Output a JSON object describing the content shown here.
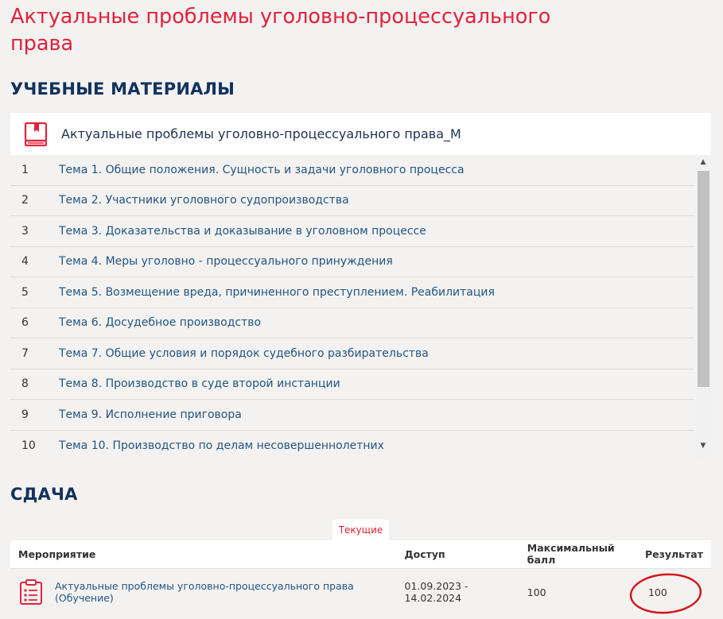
{
  "course": {
    "title": "Актуальные проблемы уголовно-процессуального права"
  },
  "materials": {
    "section_title": "УЧЕБНЫЕ МАТЕРИАЛЫ",
    "item_name": "Актуальные проблемы уголовно-процессуального права_М",
    "icon": "book-icon",
    "topics": [
      {
        "num": "1",
        "title": "Тема 1. Общие положения. Сущность и задачи уголовного процесса"
      },
      {
        "num": "2",
        "title": "Тема 2. Участники уголовного судопроизводства"
      },
      {
        "num": "3",
        "title": "Тема 3. Доказательства и доказывание в уголовном процессе"
      },
      {
        "num": "4",
        "title": "Тема 4. Меры уголовно - процессуального принуждения"
      },
      {
        "num": "5",
        "title": "Тема 5. Возмещение вреда, причиненного преступлением. Реабилитация"
      },
      {
        "num": "6",
        "title": "Тема 6. Досудебное производство"
      },
      {
        "num": "7",
        "title": "Тема 7. Общие условия и порядок судебного разбирательства"
      },
      {
        "num": "8",
        "title": "Тема 8. Производство в суде второй инстанции"
      },
      {
        "num": "9",
        "title": "Тема 9. Исполнение приговора"
      },
      {
        "num": "10",
        "title": "Тема 10. Производство по делам несовершеннолетних"
      }
    ]
  },
  "submission": {
    "section_title": "СДАЧА",
    "tab_label": "Текущие",
    "columns": {
      "event": "Мероприятие",
      "access": "Доступ",
      "max_score": "Максимальный балл",
      "result": "Результат"
    },
    "rows": [
      {
        "event": "Актуальные проблемы уголовно-процессуального права (Обучение)",
        "access": "01.09.2023 - 14.02.2024",
        "max_score": "100",
        "result": "100"
      }
    ]
  },
  "colors": {
    "accent_red": "#e2223b",
    "heading_navy": "#13325e",
    "link_blue": "#24557f",
    "background": "#f3f2f1"
  }
}
